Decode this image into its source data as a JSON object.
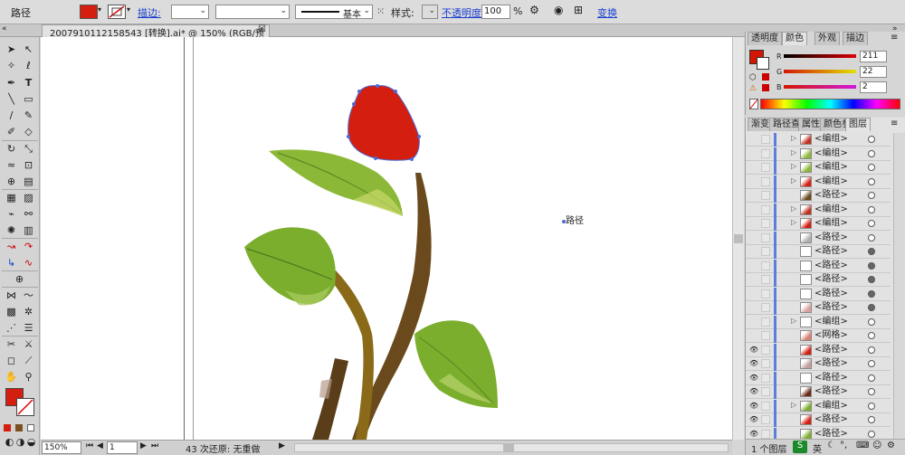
{
  "controlbar": {
    "object_type": "路径",
    "stroke_label": "描边:",
    "stroke_profile": "基本",
    "style_label": "样式:",
    "opacity_label": "不透明度:",
    "opacity_value": "100",
    "opacity_unit": "%",
    "transform_label": "变换",
    "fill_color": "#d41e10"
  },
  "document_tab": {
    "title": "2007910112158543 [转换].ai* @ 150% (RGB/预览)",
    "close_glyph": "☒"
  },
  "canvas": {
    "cursor_label": "路径"
  },
  "statusbar": {
    "zoom": "150%",
    "page": "1",
    "status_text": "43 次还原: 无重做"
  },
  "color_panel": {
    "tabs": [
      "透明度",
      "颜色",
      "外观",
      "描边"
    ],
    "active_tab": "颜色",
    "channels": [
      {
        "label": "R",
        "value": "211"
      },
      {
        "label": "G",
        "value": "22"
      },
      {
        "label": "B",
        "value": "2"
      }
    ],
    "current_color": "#d31602"
  },
  "layers_panel": {
    "tabs": [
      "渐变",
      "路径查",
      "属性",
      "颜色参",
      "图层"
    ],
    "active_tab": "图层",
    "rows": [
      {
        "name": "<编组>",
        "expandable": true,
        "visible": false,
        "target_filled": false
      },
      {
        "name": "<编组>",
        "expandable": true,
        "visible": false,
        "target_filled": false
      },
      {
        "name": "<编组>",
        "expandable": true,
        "visible": false,
        "target_filled": false
      },
      {
        "name": "<编组>",
        "expandable": true,
        "visible": false,
        "target_filled": false
      },
      {
        "name": "<路径>",
        "expandable": false,
        "visible": false,
        "target_filled": false
      },
      {
        "name": "<编组>",
        "expandable": true,
        "visible": false,
        "target_filled": false
      },
      {
        "name": "<编组>",
        "expandable": true,
        "visible": false,
        "target_filled": false
      },
      {
        "name": "<路径>",
        "expandable": false,
        "visible": false,
        "target_filled": false
      },
      {
        "name": "<路径>",
        "expandable": false,
        "visible": false,
        "target_filled": true
      },
      {
        "name": "<路径>",
        "expandable": false,
        "visible": false,
        "target_filled": true
      },
      {
        "name": "<路径>",
        "expandable": false,
        "visible": false,
        "target_filled": true
      },
      {
        "name": "<路径>",
        "expandable": false,
        "visible": false,
        "target_filled": true
      },
      {
        "name": "<路径>",
        "expandable": false,
        "visible": false,
        "target_filled": true
      },
      {
        "name": "<编组>",
        "expandable": true,
        "visible": false,
        "target_filled": false
      },
      {
        "name": "<网格>",
        "expandable": false,
        "visible": false,
        "target_filled": false
      },
      {
        "name": "<路径>",
        "expandable": false,
        "visible": true,
        "target_filled": false
      },
      {
        "name": "<路径>",
        "expandable": false,
        "visible": true,
        "target_filled": false
      },
      {
        "name": "<路径>",
        "expandable": false,
        "visible": true,
        "target_filled": false
      },
      {
        "name": "<路径>",
        "expandable": false,
        "visible": true,
        "target_filled": false
      },
      {
        "name": "<编组>",
        "expandable": true,
        "visible": true,
        "target_filled": false
      },
      {
        "name": "<路径>",
        "expandable": false,
        "visible": true,
        "target_filled": false
      },
      {
        "name": "<路径>",
        "expandable": false,
        "visible": true,
        "target_filled": false
      }
    ],
    "layer_count": "1 个图层",
    "ime_label": "英"
  }
}
